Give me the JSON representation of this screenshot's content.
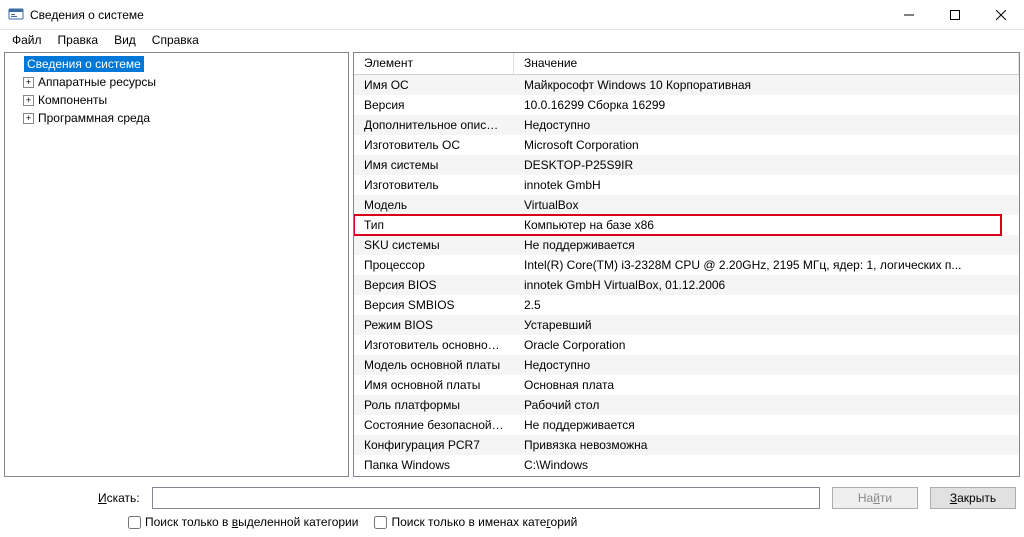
{
  "window": {
    "title": "Сведения о системе"
  },
  "menu": {
    "file": "Файл",
    "edit": "Правка",
    "view": "Вид",
    "help": "Справка"
  },
  "tree": {
    "root": "Сведения о системе",
    "children": [
      "Аппаратные ресурсы",
      "Компоненты",
      "Программная среда"
    ]
  },
  "columns": {
    "name": "Элемент",
    "value": "Значение"
  },
  "rows": [
    {
      "name": "Имя ОС",
      "value": "Майкрософт Windows 10 Корпоративная"
    },
    {
      "name": "Версия",
      "value": "10.0.16299 Сборка 16299"
    },
    {
      "name": "Дополнительное описание ОС",
      "value": "Недоступно"
    },
    {
      "name": "Изготовитель ОС",
      "value": "Microsoft Corporation"
    },
    {
      "name": "Имя системы",
      "value": "DESKTOP-P25S9IR"
    },
    {
      "name": "Изготовитель",
      "value": "innotek GmbH"
    },
    {
      "name": "Модель",
      "value": "VirtualBox"
    },
    {
      "name": "Тип",
      "value": "Компьютер на базе x86"
    },
    {
      "name": "SKU системы",
      "value": "Не поддерживается"
    },
    {
      "name": "Процессор",
      "value": "Intel(R) Core(TM) i3-2328M CPU @ 2.20GHz, 2195 МГц, ядер: 1, логических п..."
    },
    {
      "name": "Версия BIOS",
      "value": "innotek GmbH VirtualBox, 01.12.2006"
    },
    {
      "name": "Версия SMBIOS",
      "value": "2.5"
    },
    {
      "name": "Режим BIOS",
      "value": "Устаревший"
    },
    {
      "name": "Изготовитель основной платы",
      "value": "Oracle Corporation"
    },
    {
      "name": "Модель основной платы",
      "value": "Недоступно"
    },
    {
      "name": "Имя основной платы",
      "value": "Основная плата"
    },
    {
      "name": "Роль платформы",
      "value": "Рабочий стол"
    },
    {
      "name": "Состояние безопасной загруз...",
      "value": "Не поддерживается"
    },
    {
      "name": "Конфигурация PCR7",
      "value": "Привязка невозможна"
    },
    {
      "name": "Папка Windows",
      "value": "C:\\Windows"
    }
  ],
  "highlight_index": 7,
  "search": {
    "label_pre": "",
    "label_u": "И",
    "label_post": "скать:",
    "find_btn_pre": "На",
    "find_btn_u": "й",
    "find_btn_post": "ти",
    "close_btn_pre": "",
    "close_btn_u": "З",
    "close_btn_post": "акрыть",
    "check1_pre": "Поиск только в ",
    "check1_u": "в",
    "check1_post": "ыделенной категории",
    "check2_pre": "Поиск только в именах кате",
    "check2_u": "г",
    "check2_post": "орий"
  }
}
